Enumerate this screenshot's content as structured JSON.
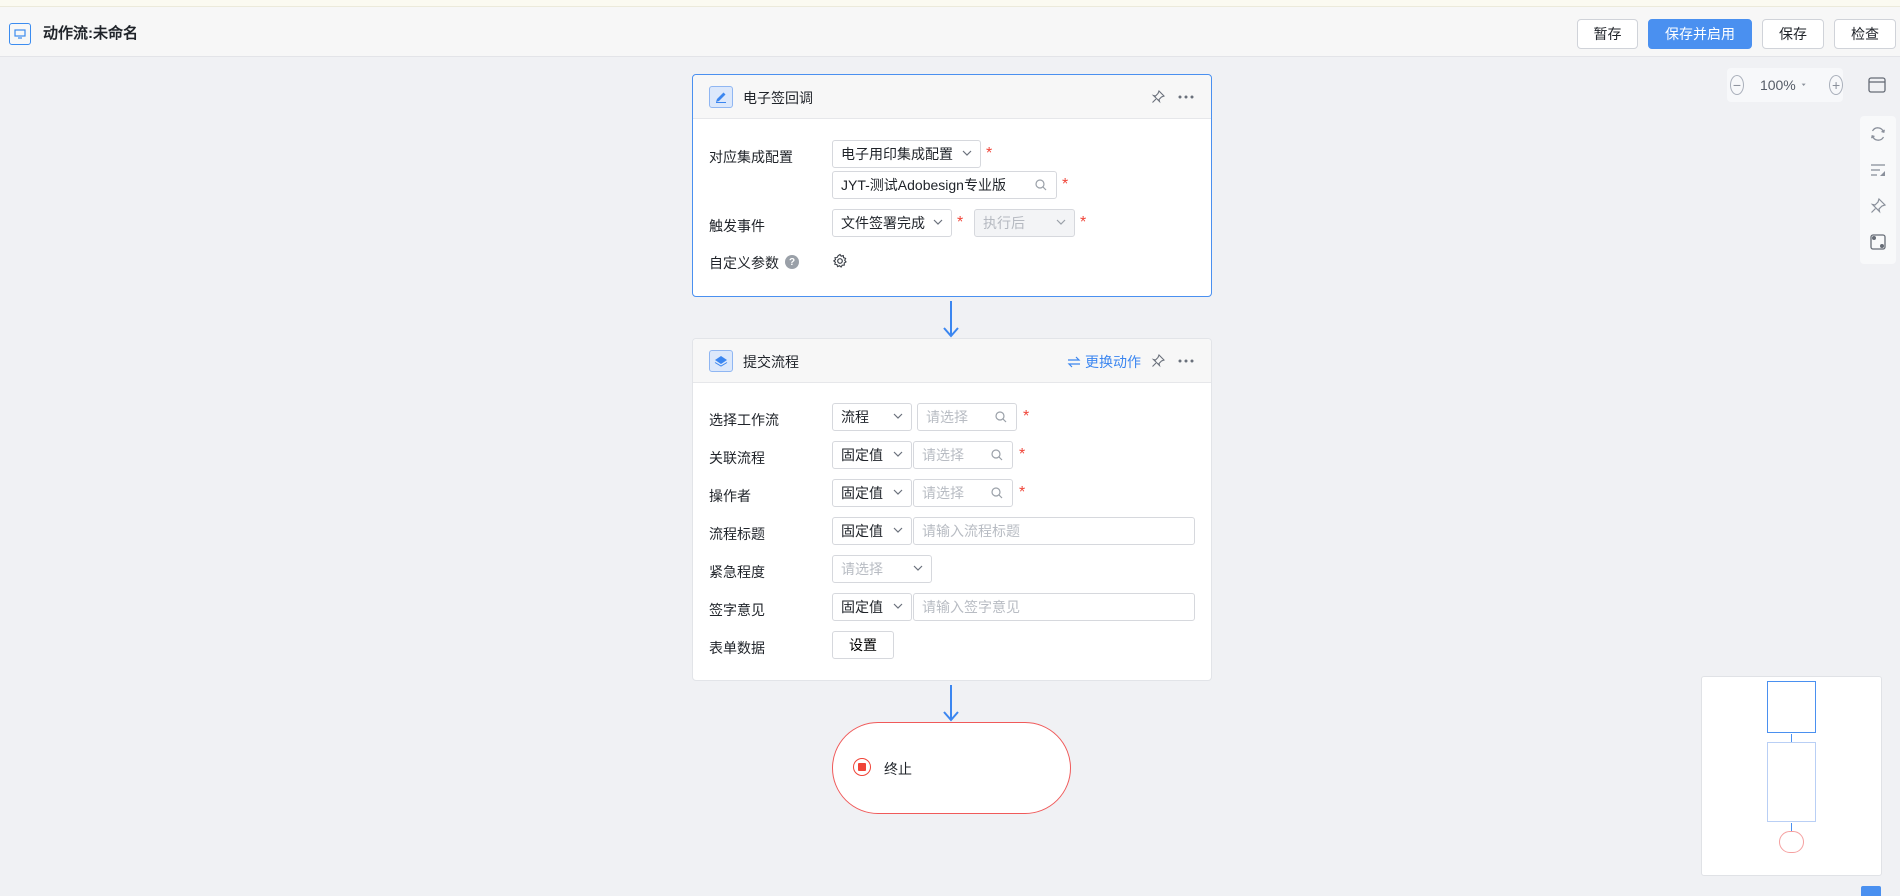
{
  "header": {
    "title": "动作流:未命名",
    "buttons": {
      "draft": "暂存",
      "save_enable": "保存并启用",
      "save": "保存",
      "check": "检查"
    }
  },
  "toolbar": {
    "zoom": "100%"
  },
  "node1": {
    "title": "电子签回调",
    "fields": {
      "integration_label": "对应集成配置",
      "integration_type": "电子用印集成配置",
      "integration_value": "JYT-测试Adobesign专业版",
      "trigger_label": "触发事件",
      "trigger_event": "文件签署完成",
      "trigger_timing": "执行后",
      "custom_params_label": "自定义参数",
      "help": "?"
    }
  },
  "node2": {
    "title": "提交流程",
    "replace_action": "更换动作",
    "fields": {
      "workflow_label": "选择工作流",
      "workflow_type": "流程",
      "workflow_placeholder": "请选择",
      "related_label": "关联流程",
      "related_type": "固定值",
      "related_placeholder": "请选择",
      "operator_label": "操作者",
      "operator_type": "固定值",
      "operator_placeholder": "请选择",
      "title_label": "流程标题",
      "title_type": "固定值",
      "title_placeholder": "请输入流程标题",
      "urgency_label": "紧急程度",
      "urgency_placeholder": "请选择",
      "opinion_label": "签字意见",
      "opinion_type": "固定值",
      "opinion_placeholder": "请输入签字意见",
      "form_label": "表单数据",
      "form_button": "设置"
    }
  },
  "end_node": {
    "label": "终止"
  },
  "colors": {
    "primary": "#4a90f0",
    "required": "#f04438",
    "end": "#f04438"
  }
}
